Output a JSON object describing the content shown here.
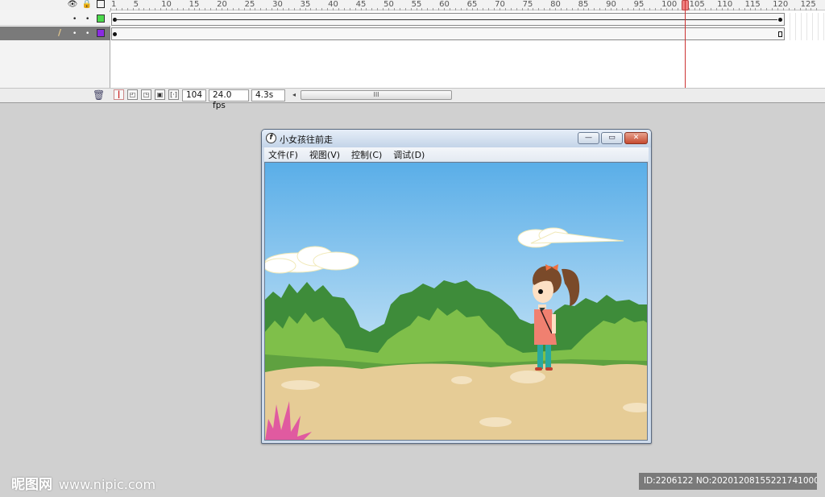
{
  "timeline": {
    "ruler_ticks": [
      "1",
      "5",
      "10",
      "15",
      "20",
      "25",
      "30",
      "35",
      "40",
      "45",
      "50",
      "55",
      "60",
      "65",
      "70",
      "75",
      "80",
      "85",
      "90",
      "95",
      "100",
      "105",
      "110",
      "115",
      "120",
      "125"
    ],
    "header_icons": [
      "eye-icon",
      "lock-icon",
      "outline-icon"
    ],
    "layers": [
      {
        "color": "#4cd94c",
        "selected": false
      },
      {
        "color": "#8a2be2",
        "selected": true
      }
    ],
    "current_frame": "104",
    "frame_rate": "24.0 fps",
    "elapsed_time": "4.3s",
    "scroll_grip": "III"
  },
  "player": {
    "title": "小女孩往前走",
    "menu": [
      "文件(F)",
      "视图(V)",
      "控制(C)",
      "调试(D)"
    ],
    "minimize_glyph": "—",
    "restore_glyph": "▭",
    "close_glyph": "✕",
    "app_icon_glyph": "f"
  },
  "watermark": {
    "logo_text": "昵图网",
    "url": "www.nipic.com",
    "id_text": "ID:2206122 NO:20201208155221741000"
  },
  "colors": {
    "sky_top": "#5aaee8",
    "sky_bottom": "#d8ecf8",
    "grass_dark": "#3e8c3a",
    "grass_light": "#7fbf4a",
    "ground": "#e6cc96",
    "playhead": "#e05050"
  }
}
